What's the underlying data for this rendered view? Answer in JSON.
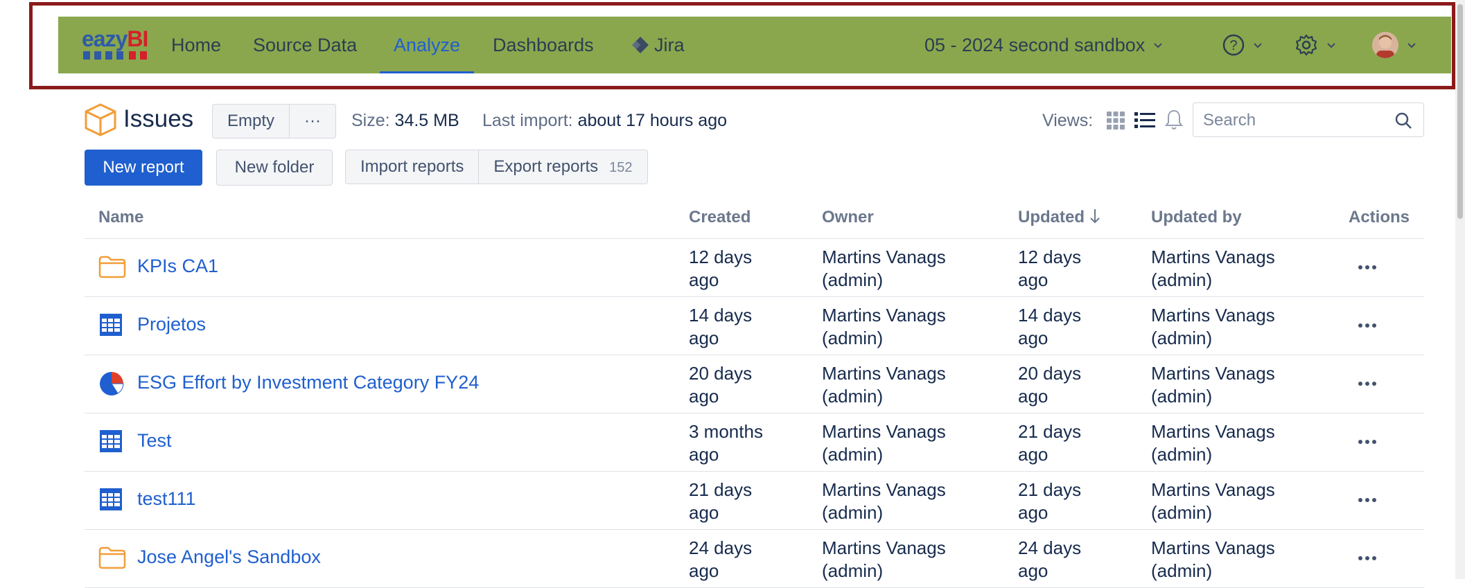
{
  "nav": {
    "logo": {
      "prefix": "eazy",
      "suffix": "BI"
    },
    "items": [
      "Home",
      "Source Data",
      "Analyze",
      "Dashboards"
    ],
    "active": "Analyze",
    "jira_label": "Jira",
    "account_name": "05 - 2024 second sandbox",
    "colors": {
      "bar": "#8aa74e",
      "active": "#1f5fcf",
      "highlight": "#8b1a1a"
    }
  },
  "header": {
    "title": "Issues",
    "empty_button": "Empty",
    "more_button": "···",
    "size_label": "Size:",
    "size_value": "34.5 MB",
    "import_label": "Last import:",
    "import_value": "about 17 hours ago",
    "views_label": "Views:",
    "search_placeholder": "Search"
  },
  "actions": {
    "new_report": "New report",
    "new_folder": "New folder",
    "import_reports": "Import reports",
    "export_reports": "Export reports",
    "report_count": "152"
  },
  "table": {
    "columns": {
      "name": "Name",
      "created": "Created",
      "owner": "Owner",
      "updated": "Updated",
      "updated_by": "Updated by",
      "actions": "Actions"
    },
    "rows": [
      {
        "name": "KPIs CA1",
        "icon": "folder-icon",
        "created_1": "12 days",
        "created_2": "ago",
        "owner_1": "Martins Vanags",
        "owner_2": "(admin)",
        "updated_1": "12 days",
        "updated_2": "ago",
        "by_1": "Martins Vanags",
        "by_2": "(admin)"
      },
      {
        "name": "Projetos",
        "icon": "table-report-icon",
        "created_1": "14 days",
        "created_2": "ago",
        "owner_1": "Martins Vanags",
        "owner_2": "(admin)",
        "updated_1": "14 days",
        "updated_2": "ago",
        "by_1": "Martins Vanags",
        "by_2": "(admin)"
      },
      {
        "name": "ESG Effort by Investment Category FY24",
        "icon": "pie-chart-icon",
        "created_1": "20 days",
        "created_2": "ago",
        "owner_1": "Martins Vanags",
        "owner_2": "(admin)",
        "updated_1": "20 days",
        "updated_2": "ago",
        "by_1": "Martins Vanags",
        "by_2": "(admin)"
      },
      {
        "name": "Test",
        "icon": "table-report-icon",
        "created_1": "3 months",
        "created_2": "ago",
        "owner_1": "Martins Vanags",
        "owner_2": "(admin)",
        "updated_1": "21 days",
        "updated_2": "ago",
        "by_1": "Martins Vanags",
        "by_2": "(admin)"
      },
      {
        "name": "test111",
        "icon": "table-report-icon",
        "created_1": "21 days",
        "created_2": "ago",
        "owner_1": "Martins Vanags",
        "owner_2": "(admin)",
        "updated_1": "21 days",
        "updated_2": "ago",
        "by_1": "Martins Vanags",
        "by_2": "(admin)"
      },
      {
        "name": "Jose Angel's Sandbox",
        "icon": "folder-icon",
        "created_1": "24 days",
        "created_2": "ago",
        "owner_1": "Martins Vanags",
        "owner_2": "(admin)",
        "updated_1": "24 days",
        "updated_2": "ago",
        "by_1": "Martins Vanags",
        "by_2": "(admin)"
      }
    ]
  }
}
